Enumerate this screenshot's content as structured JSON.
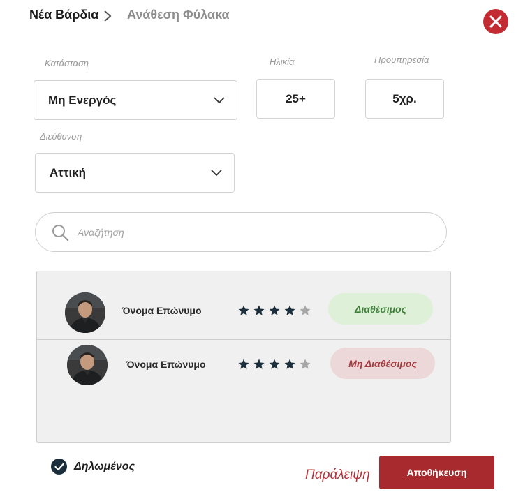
{
  "breadcrumb": {
    "current": "Νέα Βάρδια",
    "next": "Ανάθεση Φύλακα",
    "separator_icon": "chevron-right-icon"
  },
  "close_icon": "close-icon",
  "colors": {
    "accent": "#a8292e",
    "close": "#c22c32",
    "available_bg": "#dff0d8",
    "available_text": "#3f7f3a",
    "unavailable_bg": "#ecd8d8",
    "unavailable_text": "#a83a40",
    "star_filled": "#1a2e3b",
    "star_empty": "#a6a6a6"
  },
  "filters": {
    "status": {
      "label": "Κατάσταση",
      "value": "Μη Ενεργός"
    },
    "age": {
      "label": "Ηλικία",
      "value": "25+"
    },
    "service": {
      "label": "Προυπηρεσία",
      "value": "5χρ."
    },
    "direction": {
      "label": "Διεύθυνση",
      "value": "Αττική"
    }
  },
  "search": {
    "placeholder": "Αναζήτηση",
    "value": ""
  },
  "guards": [
    {
      "name": "Όνομα Επώνυμο",
      "rating": 4,
      "max_rating": 5,
      "status": "Διαθέσιμος",
      "available": true
    },
    {
      "name": "Όνομα Επώνυμο",
      "rating": 4,
      "max_rating": 5,
      "status": "Μη Διαθέσιμος",
      "available": false
    }
  ],
  "declared": {
    "label": "Δηλωμένος",
    "checked": true
  },
  "actions": {
    "skip": "Παράλειψη",
    "save": "Αποθήκευση"
  }
}
